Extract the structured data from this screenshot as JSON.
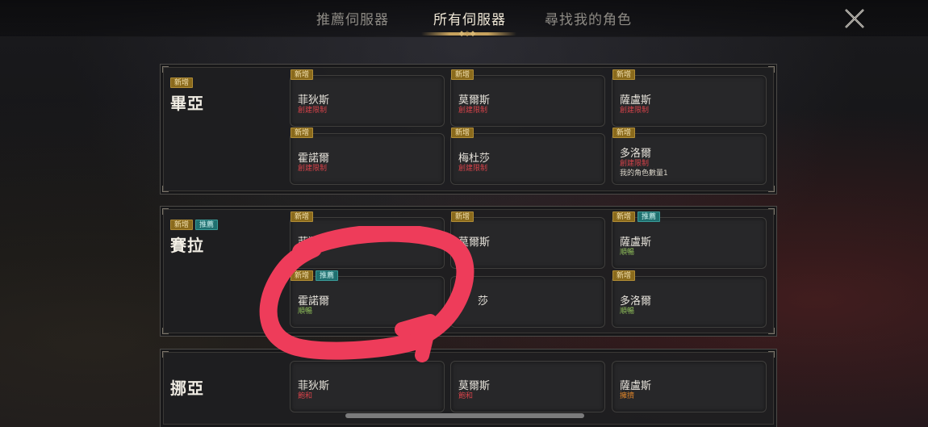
{
  "nav": {
    "tabs": [
      {
        "label": "推薦伺服器",
        "active": false
      },
      {
        "label": "所有伺服器",
        "active": true
      },
      {
        "label": "尋找我的角色",
        "active": false
      }
    ],
    "close_icon": "close-x-icon"
  },
  "badge_labels": {
    "new": "新增",
    "recommended": "推薦"
  },
  "colors": {
    "accent_gold": "#c6a15c",
    "status_red": "#d8434a",
    "status_green": "#8fbf5a",
    "status_orange": "#e0862a",
    "annotation_red": "#ee3c5a"
  },
  "regions": [
    {
      "name": "畢亞",
      "badges": [
        "新增"
      ],
      "servers": [
        {
          "name": "菲狄斯",
          "badges": [
            "新增"
          ],
          "status": "創建限制",
          "status_type": "red"
        },
        {
          "name": "莫爾斯",
          "badges": [
            "新增"
          ],
          "status": "創建限制",
          "status_type": "red"
        },
        {
          "name": "薩盧斯",
          "badges": [
            "新增"
          ],
          "status": "創建限制",
          "status_type": "red"
        },
        {
          "name": "霍諾爾",
          "badges": [
            "新增"
          ],
          "status": "創建限制",
          "status_type": "red"
        },
        {
          "name": "梅杜莎",
          "badges": [
            "新增"
          ],
          "status": "創建限制",
          "status_type": "red"
        },
        {
          "name": "多洛爾",
          "badges": [
            "新增"
          ],
          "status": "創建限制",
          "status_type": "red",
          "extra": "我的角色數量1"
        }
      ]
    },
    {
      "name": "賽拉",
      "badges": [
        "新增",
        "推薦"
      ],
      "servers": [
        {
          "name": "菲狄斯",
          "badges": [
            "新增"
          ],
          "status": "",
          "status_type": "green"
        },
        {
          "name": "莫爾斯",
          "badges": [
            "新增"
          ],
          "status": "",
          "status_type": "green"
        },
        {
          "name": "薩盧斯",
          "badges": [
            "新增",
            "推薦"
          ],
          "status": "順暢",
          "status_type": "green"
        },
        {
          "name": "霍諾爾",
          "badges": [
            "新增",
            "推薦"
          ],
          "status": "順暢",
          "status_type": "green"
        },
        {
          "name": "莎",
          "badges": [],
          "status": "",
          "status_type": "green"
        },
        {
          "name": "多洛爾",
          "badges": [
            "新增"
          ],
          "status": "順暢",
          "status_type": "green"
        }
      ]
    },
    {
      "name": "挪亞",
      "badges": [],
      "servers": [
        {
          "name": "菲狄斯",
          "badges": [],
          "status": "飽和",
          "status_type": "red"
        },
        {
          "name": "莫爾斯",
          "badges": [],
          "status": "飽和",
          "status_type": "red"
        },
        {
          "name": "薩盧斯",
          "badges": [],
          "status": "擁擠",
          "status_type": "orange"
        }
      ]
    }
  ]
}
